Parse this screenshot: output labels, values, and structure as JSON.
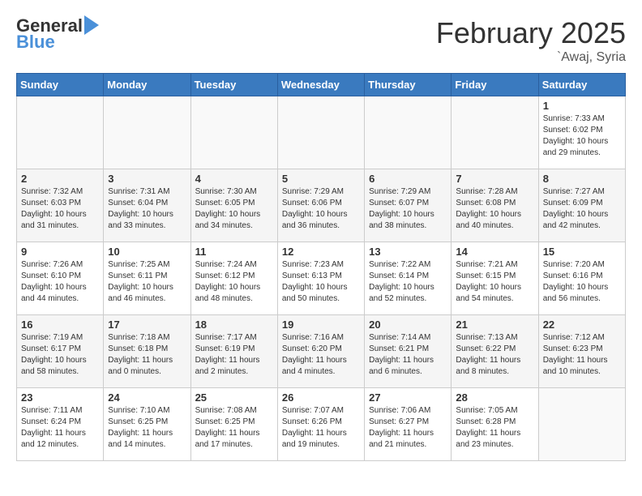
{
  "header": {
    "logo_line1": "General",
    "logo_line2": "Blue",
    "month_year": "February 2025",
    "location": "`Awaj, Syria"
  },
  "days_of_week": [
    "Sunday",
    "Monday",
    "Tuesday",
    "Wednesday",
    "Thursday",
    "Friday",
    "Saturday"
  ],
  "weeks": [
    [
      {
        "day": "",
        "info": ""
      },
      {
        "day": "",
        "info": ""
      },
      {
        "day": "",
        "info": ""
      },
      {
        "day": "",
        "info": ""
      },
      {
        "day": "",
        "info": ""
      },
      {
        "day": "",
        "info": ""
      },
      {
        "day": "1",
        "info": "Sunrise: 7:33 AM\nSunset: 6:02 PM\nDaylight: 10 hours and 29 minutes."
      }
    ],
    [
      {
        "day": "2",
        "info": "Sunrise: 7:32 AM\nSunset: 6:03 PM\nDaylight: 10 hours and 31 minutes."
      },
      {
        "day": "3",
        "info": "Sunrise: 7:31 AM\nSunset: 6:04 PM\nDaylight: 10 hours and 33 minutes."
      },
      {
        "day": "4",
        "info": "Sunrise: 7:30 AM\nSunset: 6:05 PM\nDaylight: 10 hours and 34 minutes."
      },
      {
        "day": "5",
        "info": "Sunrise: 7:29 AM\nSunset: 6:06 PM\nDaylight: 10 hours and 36 minutes."
      },
      {
        "day": "6",
        "info": "Sunrise: 7:29 AM\nSunset: 6:07 PM\nDaylight: 10 hours and 38 minutes."
      },
      {
        "day": "7",
        "info": "Sunrise: 7:28 AM\nSunset: 6:08 PM\nDaylight: 10 hours and 40 minutes."
      },
      {
        "day": "8",
        "info": "Sunrise: 7:27 AM\nSunset: 6:09 PM\nDaylight: 10 hours and 42 minutes."
      }
    ],
    [
      {
        "day": "9",
        "info": "Sunrise: 7:26 AM\nSunset: 6:10 PM\nDaylight: 10 hours and 44 minutes."
      },
      {
        "day": "10",
        "info": "Sunrise: 7:25 AM\nSunset: 6:11 PM\nDaylight: 10 hours and 46 minutes."
      },
      {
        "day": "11",
        "info": "Sunrise: 7:24 AM\nSunset: 6:12 PM\nDaylight: 10 hours and 48 minutes."
      },
      {
        "day": "12",
        "info": "Sunrise: 7:23 AM\nSunset: 6:13 PM\nDaylight: 10 hours and 50 minutes."
      },
      {
        "day": "13",
        "info": "Sunrise: 7:22 AM\nSunset: 6:14 PM\nDaylight: 10 hours and 52 minutes."
      },
      {
        "day": "14",
        "info": "Sunrise: 7:21 AM\nSunset: 6:15 PM\nDaylight: 10 hours and 54 minutes."
      },
      {
        "day": "15",
        "info": "Sunrise: 7:20 AM\nSunset: 6:16 PM\nDaylight: 10 hours and 56 minutes."
      }
    ],
    [
      {
        "day": "16",
        "info": "Sunrise: 7:19 AM\nSunset: 6:17 PM\nDaylight: 10 hours and 58 minutes."
      },
      {
        "day": "17",
        "info": "Sunrise: 7:18 AM\nSunset: 6:18 PM\nDaylight: 11 hours and 0 minutes."
      },
      {
        "day": "18",
        "info": "Sunrise: 7:17 AM\nSunset: 6:19 PM\nDaylight: 11 hours and 2 minutes."
      },
      {
        "day": "19",
        "info": "Sunrise: 7:16 AM\nSunset: 6:20 PM\nDaylight: 11 hours and 4 minutes."
      },
      {
        "day": "20",
        "info": "Sunrise: 7:14 AM\nSunset: 6:21 PM\nDaylight: 11 hours and 6 minutes."
      },
      {
        "day": "21",
        "info": "Sunrise: 7:13 AM\nSunset: 6:22 PM\nDaylight: 11 hours and 8 minutes."
      },
      {
        "day": "22",
        "info": "Sunrise: 7:12 AM\nSunset: 6:23 PM\nDaylight: 11 hours and 10 minutes."
      }
    ],
    [
      {
        "day": "23",
        "info": "Sunrise: 7:11 AM\nSunset: 6:24 PM\nDaylight: 11 hours and 12 minutes."
      },
      {
        "day": "24",
        "info": "Sunrise: 7:10 AM\nSunset: 6:25 PM\nDaylight: 11 hours and 14 minutes."
      },
      {
        "day": "25",
        "info": "Sunrise: 7:08 AM\nSunset: 6:25 PM\nDaylight: 11 hours and 17 minutes."
      },
      {
        "day": "26",
        "info": "Sunrise: 7:07 AM\nSunset: 6:26 PM\nDaylight: 11 hours and 19 minutes."
      },
      {
        "day": "27",
        "info": "Sunrise: 7:06 AM\nSunset: 6:27 PM\nDaylight: 11 hours and 21 minutes."
      },
      {
        "day": "28",
        "info": "Sunrise: 7:05 AM\nSunset: 6:28 PM\nDaylight: 11 hours and 23 minutes."
      },
      {
        "day": "",
        "info": ""
      }
    ]
  ]
}
